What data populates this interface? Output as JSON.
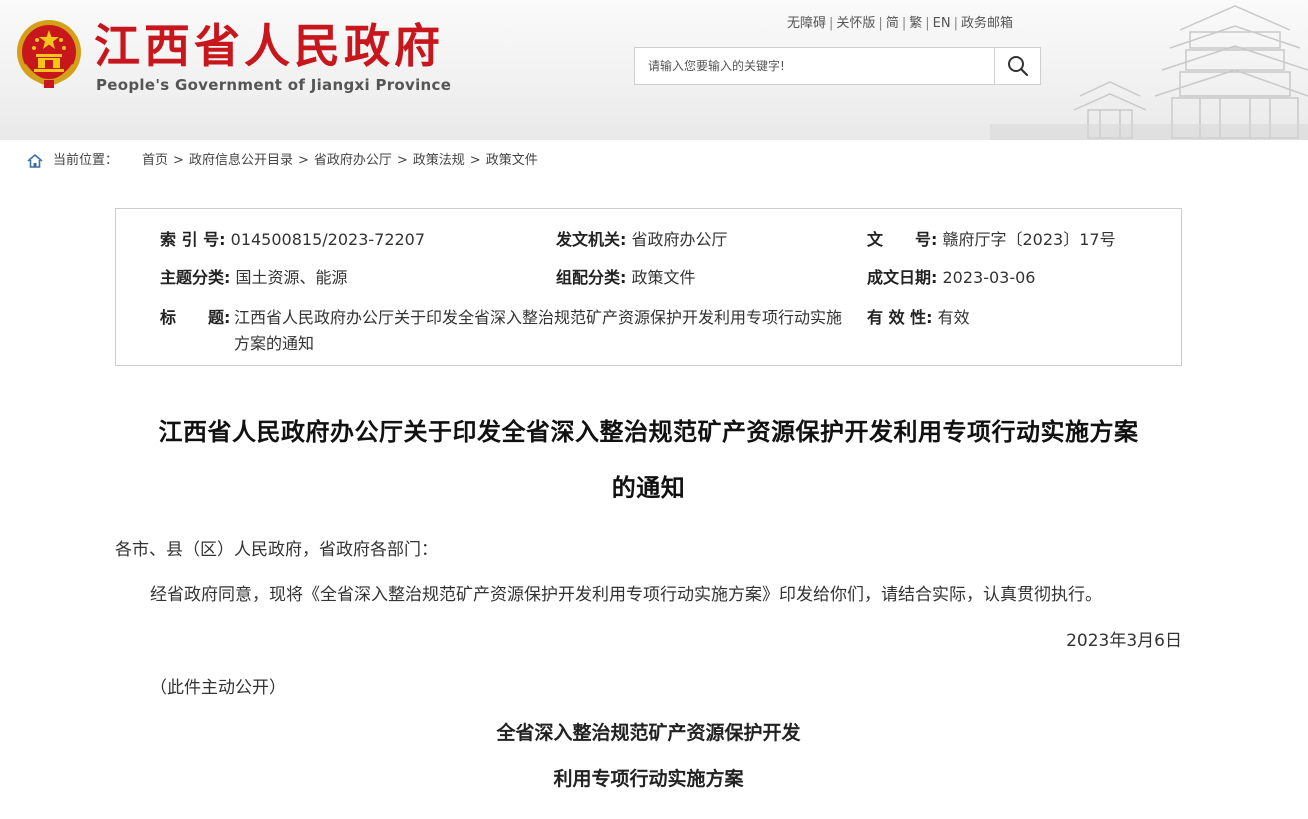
{
  "header": {
    "site_title": "江西省人民政府",
    "site_subtitle": "People's Government of Jiangxi Province",
    "top_links": [
      "无障碍",
      "关怀版",
      "简",
      "繁",
      "EN",
      "政务邮箱"
    ],
    "search_placeholder": "请输入您要输入的关键字!"
  },
  "breadcrumb": {
    "label": "当前位置：",
    "items": [
      "首页",
      "政府信息公开目录",
      "省政府办公厅",
      "政策法规",
      "政策文件"
    ],
    "separator": ">"
  },
  "meta": {
    "index_no_label": "索 引 号:",
    "index_no": "014500815/2023-72207",
    "issuer_label": "发文机关:",
    "issuer": "省政府办公厅",
    "doc_no_label": "文　　号:",
    "doc_no": "赣府厅字〔2023〕17号",
    "topic_label": "主题分类:",
    "topic": "国土资源、能源",
    "category_label": "组配分类:",
    "category": "政策文件",
    "date_label": "成文日期:",
    "date": "2023-03-06",
    "title_label": "标　　题:",
    "title": "江西省人民政府办公厅关于印发全省深入整治规范矿产资源保护开发利用专项行动实施方案的通知",
    "validity_label": "有 效 性:",
    "validity": "有效"
  },
  "article": {
    "title_line1": "江西省人民政府办公厅关于印发全省深入整治规范矿产资源保护开发利用专项行动实施方案",
    "title_line2": "的通知",
    "salutation": "各市、县（区）人民政府，省政府各部门：",
    "body": "经省政府同意，现将《全省深入整治规范矿产资源保护开发利用专项行动实施方案》印发给你们，请结合实际，认真贯彻执行。",
    "date": "2023年3月6日",
    "public_note": "（此件主动公开）",
    "plan_title_line1": "全省深入整治规范矿产资源保护开发",
    "plan_title_line2": "利用专项行动实施方案"
  },
  "colors": {
    "brand_red": "#c8161d",
    "border": "#cccccc",
    "text": "#333333"
  },
  "icons": {
    "emblem": "national-emblem-icon",
    "search": "search-icon",
    "home": "home-icon"
  }
}
